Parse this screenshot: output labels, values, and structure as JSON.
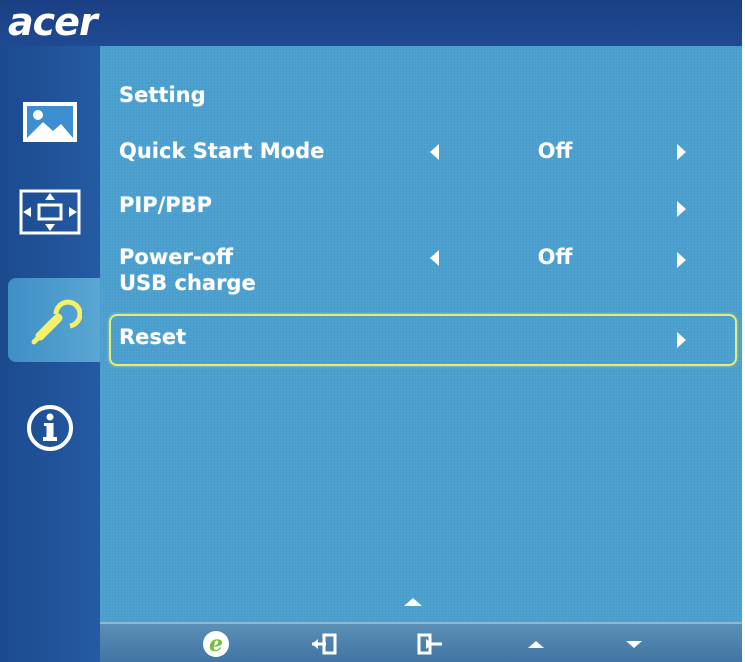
{
  "brand": "acer",
  "nav": [
    {
      "icon": "picture-icon"
    },
    {
      "icon": "osd-position-icon"
    },
    {
      "icon": "settings-wrench-icon",
      "active": true
    },
    {
      "icon": "info-icon"
    }
  ],
  "menu": {
    "title": "Setting",
    "rows": [
      {
        "label": "Quick Start Mode",
        "value": "Off",
        "left_arrow": true,
        "right_arrow": true
      },
      {
        "label": "PIP/PBP",
        "value": "",
        "left_arrow": false,
        "right_arrow": true
      },
      {
        "label_line1": "Power-off",
        "label_line2": "USB charge",
        "value": "Off",
        "left_arrow": true,
        "right_arrow": true
      },
      {
        "label": "Reset",
        "value": "",
        "left_arrow": false,
        "right_arrow": true,
        "selected": true
      }
    ]
  },
  "bottom_buttons": [
    "e-key-icon",
    "exit-icon",
    "enter-icon",
    "up-icon",
    "down-icon"
  ],
  "colors": {
    "panel": "#4ba0cf",
    "frame": "#1f4f95",
    "highlight": "#e6ec7a",
    "e_key": "#6fc23a"
  }
}
